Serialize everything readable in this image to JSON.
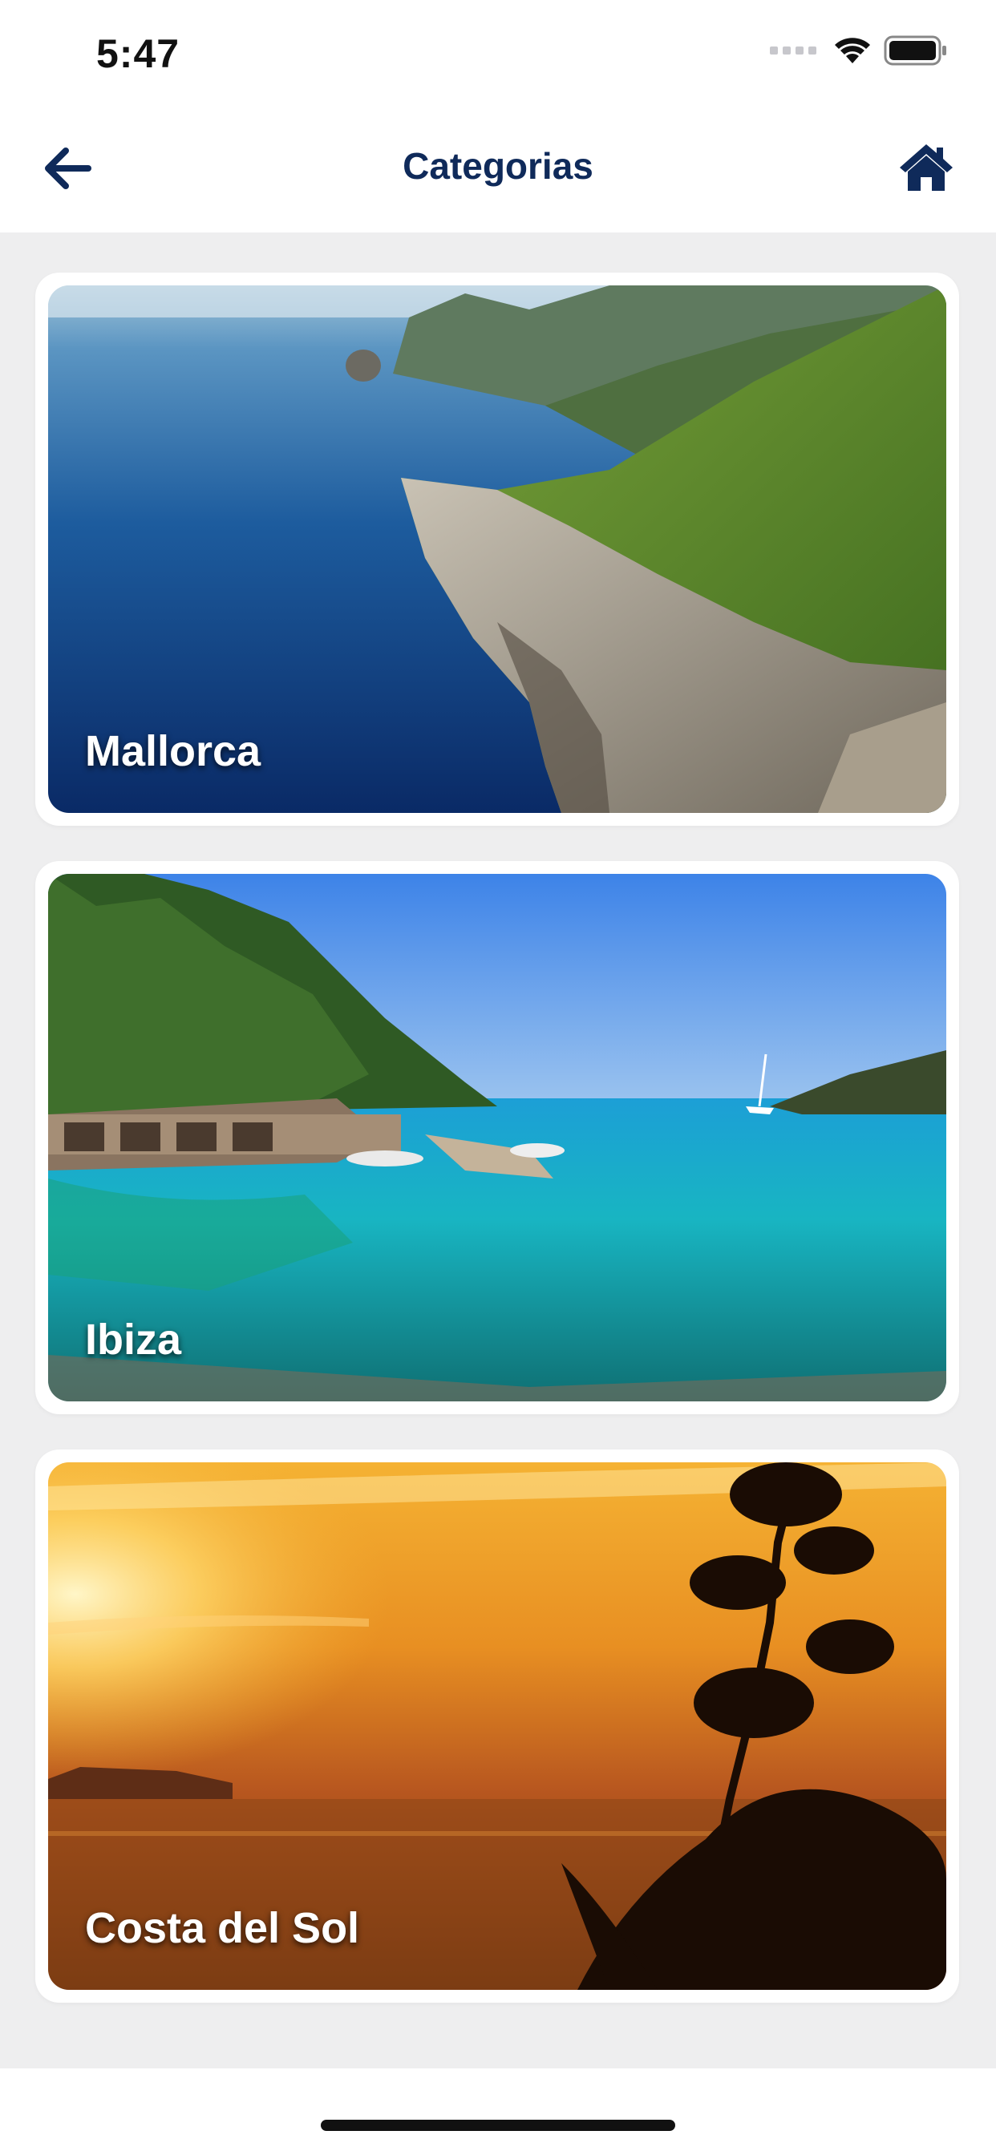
{
  "status_bar": {
    "time": "5:47"
  },
  "nav": {
    "title": "Categorias",
    "back_icon": "arrow-left-icon",
    "home_icon": "home-icon"
  },
  "colors": {
    "nav_text": "#0f2a5a",
    "background": "#eeeeef",
    "card": "#ffffff"
  },
  "categories": [
    {
      "label": "Mallorca",
      "image": "coastal-cliffs-sea"
    },
    {
      "label": "Ibiza",
      "image": "turquoise-cove-boats"
    },
    {
      "label": "Costa del Sol",
      "image": "orange-sunset-silhouette"
    }
  ]
}
